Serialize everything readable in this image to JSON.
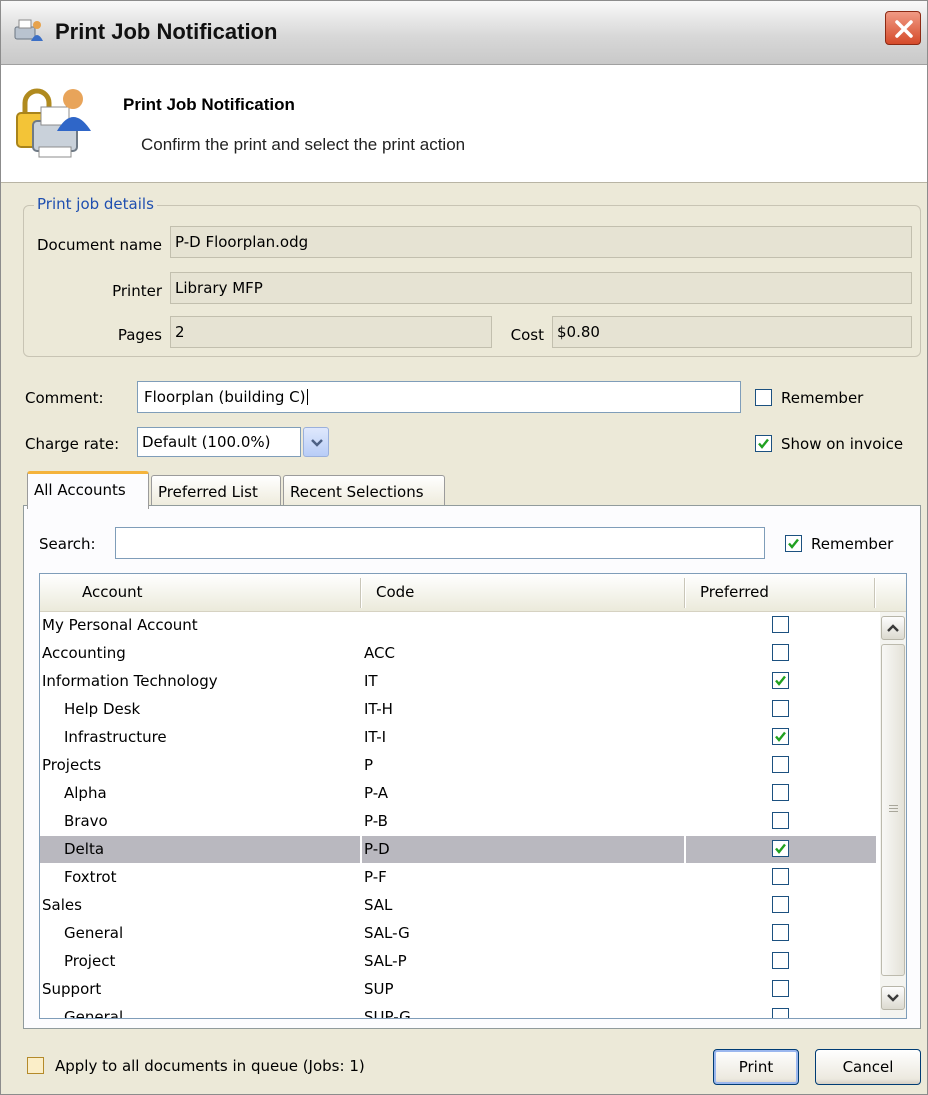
{
  "window": {
    "title": "Print Job Notification"
  },
  "header": {
    "title": "Print Job Notification",
    "subtitle": "Confirm the print and select the print action"
  },
  "details": {
    "legend": "Print job details",
    "document_label": "Document name",
    "document_value": "P-D Floorplan.odg",
    "printer_label": "Printer",
    "printer_value": "Library MFP",
    "pages_label": "Pages",
    "pages_value": "2",
    "cost_label": "Cost",
    "cost_value": "$0.80"
  },
  "form": {
    "comment_label": "Comment:",
    "comment_value": "Floorplan (building C)",
    "remember_label": "Remember",
    "remember_checked": false,
    "charge_label": "Charge rate:",
    "charge_value": "Default (100.0%)",
    "invoice_label": "Show on invoice",
    "invoice_checked": true
  },
  "tabs": [
    {
      "label": "All Accounts",
      "active": true
    },
    {
      "label": "Preferred List",
      "active": false
    },
    {
      "label": "Recent Selections",
      "active": false
    }
  ],
  "search": {
    "label": "Search:",
    "value": "",
    "remember_label": "Remember",
    "remember_checked": true
  },
  "table": {
    "columns": [
      "Account",
      "Code",
      "Preferred"
    ],
    "rows": [
      {
        "account": "My Personal Account",
        "code": "",
        "preferred": false,
        "indent": 0,
        "selected": false
      },
      {
        "account": "Accounting",
        "code": "ACC",
        "preferred": false,
        "indent": 0,
        "selected": false
      },
      {
        "account": "Information Technology",
        "code": "IT",
        "preferred": true,
        "indent": 0,
        "selected": false
      },
      {
        "account": "Help Desk",
        "code": "IT-H",
        "preferred": false,
        "indent": 1,
        "selected": false
      },
      {
        "account": "Infrastructure",
        "code": "IT-I",
        "preferred": true,
        "indent": 1,
        "selected": false
      },
      {
        "account": "Projects",
        "code": "P",
        "preferred": false,
        "indent": 0,
        "selected": false
      },
      {
        "account": "Alpha",
        "code": "P-A",
        "preferred": false,
        "indent": 1,
        "selected": false
      },
      {
        "account": "Bravo",
        "code": "P-B",
        "preferred": false,
        "indent": 1,
        "selected": false
      },
      {
        "account": "Delta",
        "code": "P-D",
        "preferred": true,
        "indent": 1,
        "selected": true
      },
      {
        "account": "Foxtrot",
        "code": "P-F",
        "preferred": false,
        "indent": 1,
        "selected": false
      },
      {
        "account": "Sales",
        "code": "SAL",
        "preferred": false,
        "indent": 0,
        "selected": false
      },
      {
        "account": "General",
        "code": "SAL-G",
        "preferred": false,
        "indent": 1,
        "selected": false
      },
      {
        "account": "Project",
        "code": "SAL-P",
        "preferred": false,
        "indent": 1,
        "selected": false
      },
      {
        "account": "Support",
        "code": "SUP",
        "preferred": false,
        "indent": 0,
        "selected": false
      },
      {
        "account": "General",
        "code": "SUP-G",
        "preferred": false,
        "indent": 1,
        "selected": false
      }
    ]
  },
  "footer": {
    "apply_label": "Apply to all documents in queue (Jobs: 1)",
    "apply_checked": false,
    "print_label": "Print",
    "cancel_label": "Cancel"
  },
  "colors": {
    "legend": "#1f4fb0",
    "check": "#21a121",
    "selected_row": "#b9b8bf",
    "active_tab": "#f4b33c"
  },
  "icons": {
    "title": "printer-user-icon",
    "header": "locked-printer-user-icon",
    "close": "close-icon",
    "dropdown": "chevron-down-icon",
    "scroll_up": "chevron-up-icon",
    "scroll_down": "chevron-down-icon"
  }
}
